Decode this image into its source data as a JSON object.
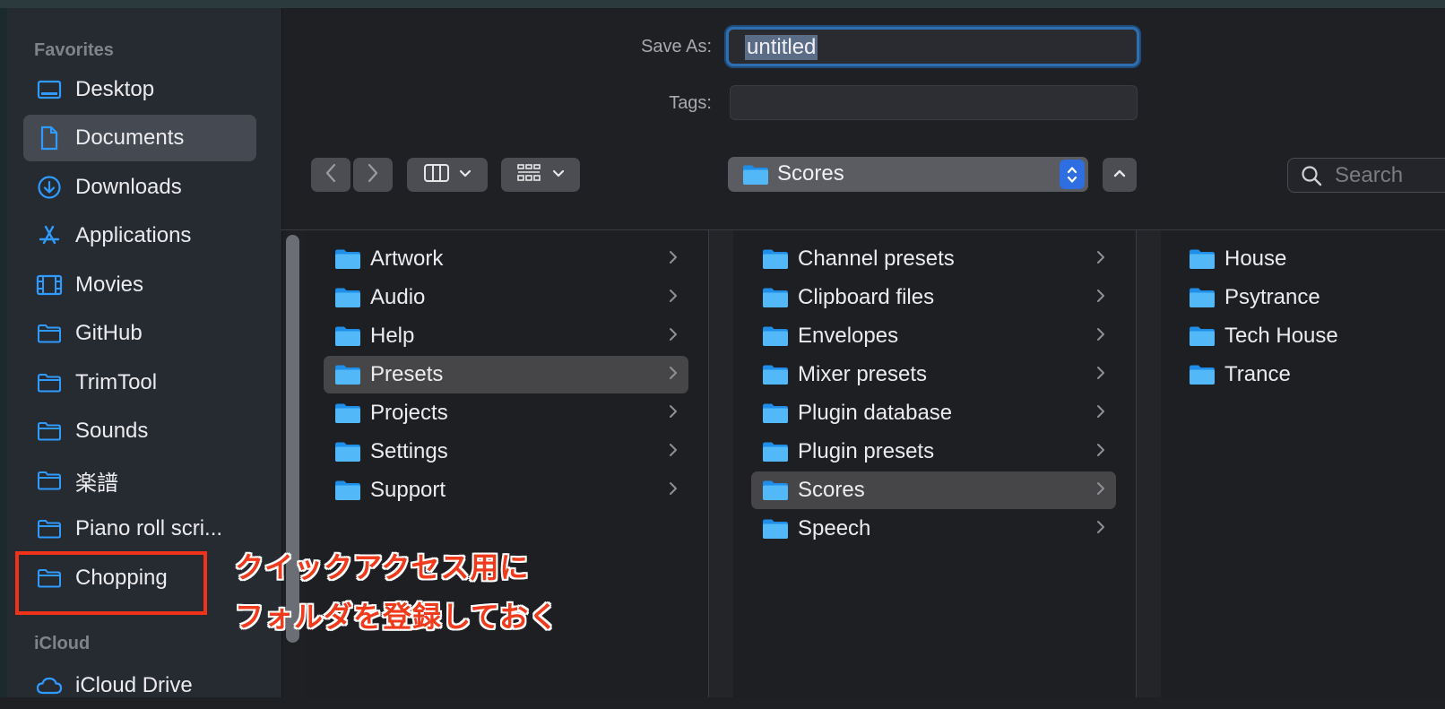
{
  "sidebar": {
    "favorites_heading": "Favorites",
    "icloud_heading": "iCloud",
    "items": [
      {
        "label": "Desktop",
        "icon": "desktop-icon"
      },
      {
        "label": "Documents",
        "icon": "document-icon",
        "selected": true
      },
      {
        "label": "Downloads",
        "icon": "download-icon"
      },
      {
        "label": "Applications",
        "icon": "applications-icon"
      },
      {
        "label": "Movies",
        "icon": "film-icon"
      },
      {
        "label": "GitHub",
        "icon": "folder-icon"
      },
      {
        "label": "TrimTool",
        "icon": "folder-icon"
      },
      {
        "label": "Sounds",
        "icon": "folder-icon"
      },
      {
        "label": "楽譜",
        "icon": "folder-icon"
      },
      {
        "label": "Piano roll scri...",
        "icon": "folder-icon"
      },
      {
        "label": "Chopping",
        "icon": "folder-icon"
      }
    ],
    "icloud_item": "iCloud Drive"
  },
  "header": {
    "save_as_label": "Save As:",
    "save_as_value": "untitled",
    "tags_label": "Tags:",
    "tags_value": ""
  },
  "toolbar": {
    "location": "Scores",
    "search_placeholder": "Search"
  },
  "columns": [
    {
      "items": [
        {
          "name": "Artwork",
          "has_children": true
        },
        {
          "name": "Audio",
          "has_children": true
        },
        {
          "name": "Help",
          "has_children": true
        },
        {
          "name": "Presets",
          "has_children": true,
          "selected": true
        },
        {
          "name": "Projects",
          "has_children": true
        },
        {
          "name": "Settings",
          "has_children": true
        },
        {
          "name": "Support",
          "has_children": true
        }
      ]
    },
    {
      "items": [
        {
          "name": "Channel presets",
          "has_children": true
        },
        {
          "name": "Clipboard files",
          "has_children": true
        },
        {
          "name": "Envelopes",
          "has_children": true
        },
        {
          "name": "Mixer presets",
          "has_children": true
        },
        {
          "name": "Plugin database",
          "has_children": true
        },
        {
          "name": "Plugin presets",
          "has_children": true
        },
        {
          "name": "Scores",
          "has_children": true,
          "selected": true
        },
        {
          "name": "Speech",
          "has_children": true
        }
      ]
    },
    {
      "items": [
        {
          "name": "House",
          "has_children": false
        },
        {
          "name": "Psytrance",
          "has_children": false
        },
        {
          "name": "Tech House",
          "has_children": false
        },
        {
          "name": "Trance",
          "has_children": false
        }
      ]
    }
  ],
  "annotation": {
    "line1": "クイックアクセス用に",
    "line2": "フォルダを登録しておく",
    "color": "#f0321a"
  },
  "colors": {
    "accent": "#2f9bff",
    "folder": "#3ba7f2",
    "selection": "#464649"
  }
}
